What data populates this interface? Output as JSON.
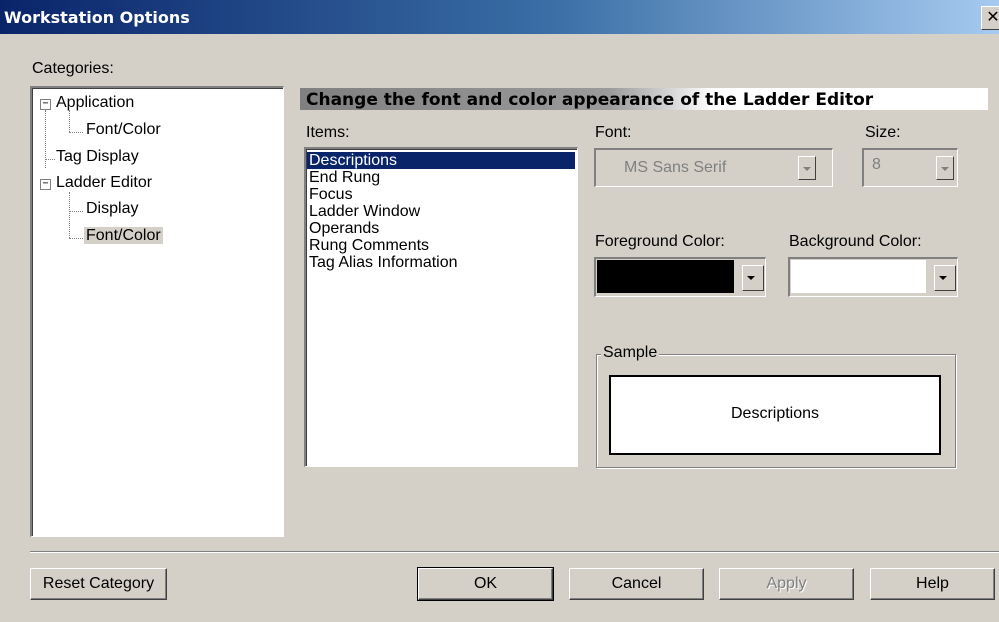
{
  "window": {
    "title": "Workstation Options",
    "close_glyph": "✕"
  },
  "categories": {
    "label": "Categories:",
    "tree": [
      {
        "label": "Application",
        "expander": "−"
      },
      {
        "label": "Font/Color"
      },
      {
        "label": "Tag Display"
      },
      {
        "label": "Ladder Editor",
        "expander": "−"
      },
      {
        "label": "Display"
      },
      {
        "label": "Font/Color",
        "selected": true
      }
    ]
  },
  "panel": {
    "header": "Change the font and color appearance of the Ladder Editor",
    "items_label": "Items:",
    "items": [
      "Descriptions",
      "End Rung",
      "Focus",
      "Ladder Window",
      "Operands",
      "Rung Comments",
      "Tag Alias Information"
    ],
    "selected_item": "Descriptions",
    "font_label": "Font:",
    "font_value": "MS Sans Serif",
    "size_label": "Size:",
    "size_value": "8",
    "foreground_label": "Foreground Color:",
    "foreground_color": "#000000",
    "background_label": "Background Color:",
    "background_color": "#ffffff",
    "sample_label": "Sample",
    "sample_text": "Descriptions"
  },
  "buttons": {
    "reset": "Reset Category",
    "ok": "OK",
    "cancel": "Cancel",
    "apply": "Apply",
    "help": "Help"
  },
  "colors": {
    "title_bar_start": "#0a246a",
    "dialog_bg": "#d4d0c8",
    "selection": "#0a246a"
  }
}
